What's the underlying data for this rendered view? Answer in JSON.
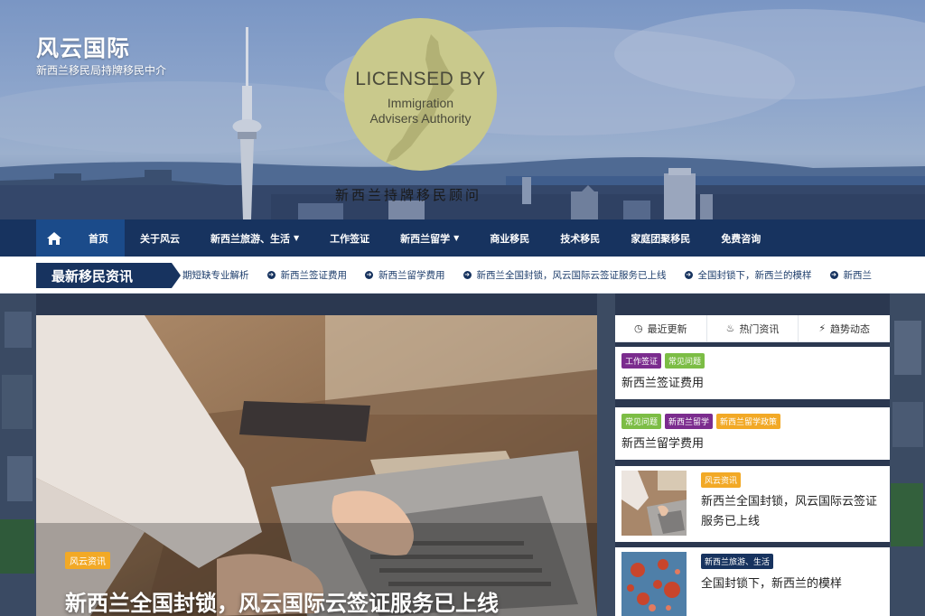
{
  "site": {
    "title": "风云国际",
    "subtitle": "新西兰移民局持牌移民中介"
  },
  "seal": {
    "line1": "LICENSED BY",
    "line2": "Immigration",
    "line3": "Advisers Authority"
  },
  "banner_caption": "新西兰持牌移民顾问",
  "nav": {
    "home_icon": "home-icon",
    "items": [
      {
        "label": "首页",
        "active": true,
        "dropdown": false
      },
      {
        "label": "关于风云",
        "active": false,
        "dropdown": false
      },
      {
        "label": "新西兰旅游、生活",
        "active": false,
        "dropdown": true
      },
      {
        "label": "工作签证",
        "active": false,
        "dropdown": false
      },
      {
        "label": "新西兰留学",
        "active": false,
        "dropdown": true
      },
      {
        "label": "商业移民",
        "active": false,
        "dropdown": false
      },
      {
        "label": "技术移民",
        "active": false,
        "dropdown": false
      },
      {
        "label": "家庭团聚移民",
        "active": false,
        "dropdown": false
      },
      {
        "label": "免费咨询",
        "active": false,
        "dropdown": false
      }
    ]
  },
  "ticker": {
    "label": "最新移民资讯",
    "items": [
      "期短缺专业解析",
      "新西兰签证费用",
      "新西兰留学费用",
      "新西兰全国封锁，风云国际云签证服务已上线",
      "全国封锁下，新西兰的模样",
      "新西兰"
    ]
  },
  "featured": {
    "badge": "风云资讯",
    "title": "新西兰全国封锁，风云国际云签证服务已上线"
  },
  "sidebar": {
    "tabs": [
      {
        "label": "最近更新",
        "icon": "clock-icon"
      },
      {
        "label": "热门资讯",
        "icon": "flame-icon"
      },
      {
        "label": "趋势动态",
        "icon": "bolt-icon"
      }
    ],
    "cards": [
      {
        "badges": [
          {
            "text": "工作签证",
            "color": "#7b2c8e"
          },
          {
            "text": "常见问题",
            "color": "#7cbd45"
          }
        ],
        "title": "新西兰签证费用"
      },
      {
        "badges": [
          {
            "text": "常见问题",
            "color": "#7cbd45"
          },
          {
            "text": "新西兰留学",
            "color": "#7b2c8e"
          },
          {
            "text": "新西兰留学政策",
            "color": "#f2a926"
          }
        ],
        "title": "新西兰留学费用"
      },
      {
        "badges": [
          {
            "text": "风云资讯",
            "color": "#f2a926"
          }
        ],
        "title_line1": "新西兰全国封锁，风云国际云签证",
        "title_line2": "服务已上线"
      },
      {
        "badges": [
          {
            "text": "新西兰旅游、生活",
            "color": "#17335f"
          }
        ],
        "title": "全国封锁下，新西兰的模样"
      }
    ]
  }
}
